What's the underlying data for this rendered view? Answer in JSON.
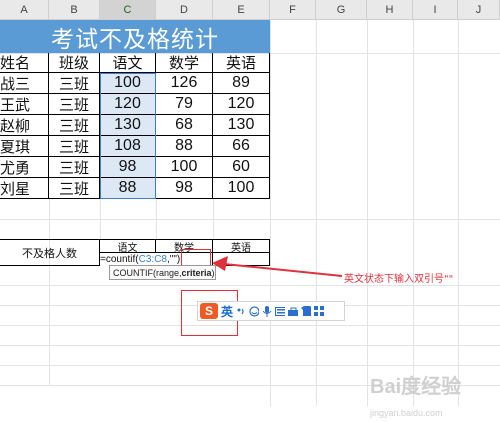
{
  "columns": [
    "A",
    "B",
    "C",
    "D",
    "E",
    "F",
    "G",
    "H",
    "I",
    "J"
  ],
  "selected_column": "C",
  "title": "考试不及格统计",
  "table": {
    "headers": [
      "姓名",
      "班级",
      "语文",
      "数学",
      "英语"
    ],
    "rows": [
      [
        "战三",
        "三班",
        "100",
        "126",
        "89"
      ],
      [
        "王武",
        "三班",
        "120",
        "79",
        "120"
      ],
      [
        "赵柳",
        "三班",
        "130",
        "68",
        "130"
      ],
      [
        "夏琪",
        "三班",
        "108",
        "88",
        "66"
      ],
      [
        "尤勇",
        "三班",
        "98",
        "100",
        "60"
      ],
      [
        "刘星",
        "三班",
        "88",
        "98",
        "100"
      ]
    ]
  },
  "summary": {
    "label": "不及格人数",
    "subjects": [
      "语文",
      "数学",
      "英语"
    ]
  },
  "formula": {
    "prefix": "=countif(",
    "range": "C3:C8",
    "suffix": ",\"\")"
  },
  "tooltip": {
    "text": "COUNTIF(range, ",
    "bold": "criteria",
    "end": ")"
  },
  "annotation": "英文状态下输入双引号\"\"",
  "ime": {
    "logo": "S",
    "mode": "英",
    "icons": [
      "punctuation-icon",
      "emoji-icon",
      "microphone-icon",
      "keyboard-icon",
      "toolbox-icon",
      "skin-icon",
      "grid-icon"
    ]
  },
  "watermark": "Bai度经验",
  "watermark_sub": "jingyan.baidu.com",
  "colors": {
    "header_blue": "#5b9bd5",
    "highlight": "#dde8f5",
    "annotation_red": "#e0323a"
  }
}
